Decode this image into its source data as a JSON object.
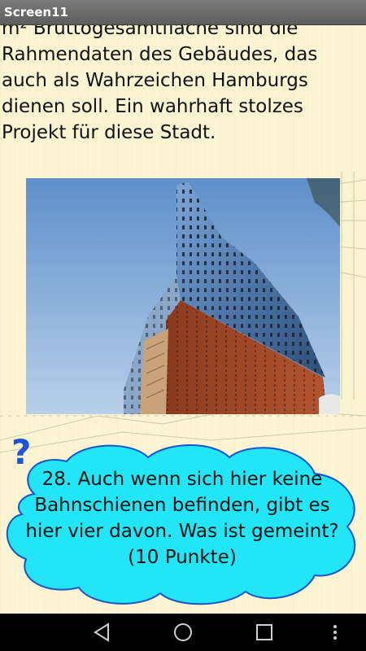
{
  "titlebar": {
    "title": "Screen11"
  },
  "content": {
    "intro_lines": [
      "m² Bruttogesamtfläche sind die",
      "Rahmendaten des Gebäudes, das",
      "auch als Wahrzeichen Hamburgs",
      "dienen soll. Ein wahrhaft stolzes",
      "Projekt für diese Stadt."
    ],
    "question_mark": "?",
    "question_lines": [
      "28. Auch wenn sich hier keine",
      "Bahnschienen befinden, gibt es",
      "hier vier davon. Was ist gemeint?",
      "(10 Punkte)"
    ]
  },
  "colors": {
    "background": "#fbf4d2",
    "cloud_fill": "#22e6f7",
    "question_mark": "#1d55d6"
  },
  "navbar": {
    "icons": [
      "back-triangle-icon",
      "home-circle-icon",
      "recents-square-icon",
      "menu-dots-icon"
    ]
  }
}
